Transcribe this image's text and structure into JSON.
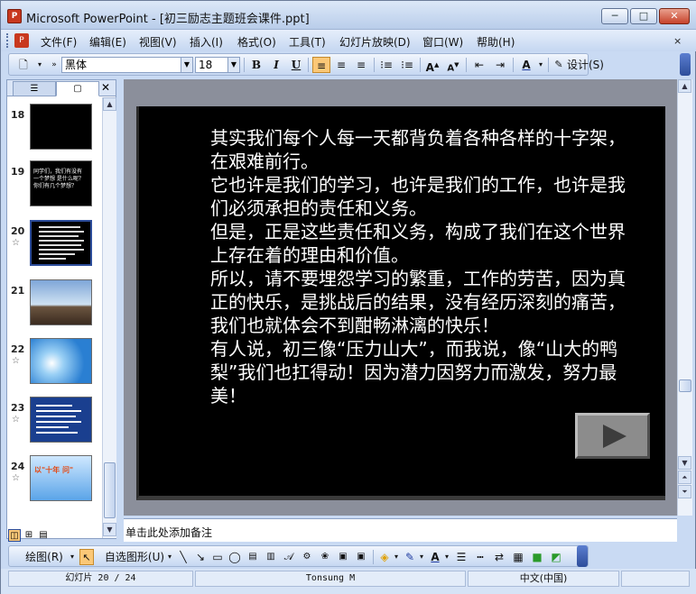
{
  "window": {
    "title": "Microsoft PowerPoint - [初三励志主题班会课件.ppt]",
    "minimize": "─",
    "maximize": "□",
    "close": "✕"
  },
  "menubar": {
    "items": [
      "文件(F)",
      "编辑(E)",
      "视图(V)",
      "插入(I)",
      "格式(O)",
      "工具(T)",
      "幻灯片放映(D)",
      "窗口(W)",
      "帮助(H)"
    ],
    "doc_close": "×"
  },
  "formatting": {
    "font": "黑体",
    "size": "18",
    "bold": "B",
    "italic": "I",
    "underline": "U",
    "design_label": "设计(S)"
  },
  "panel": {
    "tabs": [
      "outline",
      "slides"
    ],
    "slides": [
      {
        "num": "18",
        "star": false
      },
      {
        "num": "19",
        "star": false,
        "preview": "同学们，我们有没有\n一个梦想 是什么呢？\n你们有几个梦想？"
      },
      {
        "num": "20",
        "star": true
      },
      {
        "num": "21",
        "star": false
      },
      {
        "num": "22",
        "star": true
      },
      {
        "num": "23",
        "star": true
      },
      {
        "num": "24",
        "star": true,
        "preview": "以\"十年 问\""
      }
    ]
  },
  "slide": {
    "paragraphs": [
      "其实我们每个人每一天都背负着各种各样的十字架，在艰难前行。",
      "它也许是我们的学习，也许是我们的工作，也许是我们必须承担的责任和义务。",
      "但是，正是这些责任和义务，构成了我们在这个世界上存在着的理由和价值。",
      "所以，请不要埋怨学习的繁重，工作的劳苦，因为真正的快乐，是挑战后的结果，没有经历深刻的痛苦，我们也就体会不到酣畅淋漓的快乐！",
      "有人说，初三像“压力山大”，而我说，像“山大的鸭梨”我们也扛得动！因为潜力因努力而激发，努力最美！"
    ]
  },
  "notes": {
    "placeholder": "单击此处添加备注"
  },
  "drawing": {
    "draw_label": "绘图(R)",
    "autoshape_label": "自选图形(U)"
  },
  "status": {
    "slide_pos": "幻灯片 20 / 24",
    "design": "Tonsung M",
    "language": "中文(中国)"
  },
  "colors": {
    "titlebar": "#c9daf3",
    "highlight": "#fbc877",
    "stage": "#8b8f9b"
  }
}
